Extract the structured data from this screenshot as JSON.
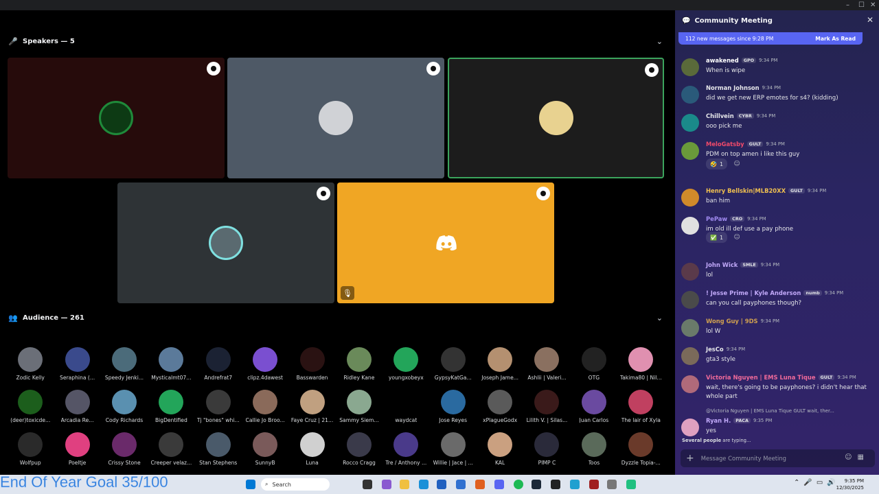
{
  "window": {
    "minimize": "–",
    "maximize": "☐",
    "close": "✕"
  },
  "speakers": {
    "title": "Speakers — 5",
    "icon": "microphone-icon",
    "chevron": "⌄"
  },
  "audience": {
    "title": "Audience — 261",
    "icon": "people-icon",
    "chevron": "⌄",
    "members": [
      "Zodic Kelly",
      "Seraphina (...",
      "Speedy Jenki...",
      "Mysticalmt07...",
      "Andrefrat7",
      "clipz.4dawest",
      "Basswarden",
      "Ridley Kane",
      "youngxobeyx",
      "GypsyKatGa...",
      "Joseph Jame...",
      "Ashlii | Valeri...",
      "OTG",
      "Takima80 | Nil...",
      "(deer)toxicde...",
      "Arcadia Re...",
      "Cody Richards",
      "BigDentified",
      "Tj \"bones\" whi...",
      "Callie Jo Broo...",
      "Faye Cruz | 21...",
      "Sammy Siem...",
      "waydcat",
      "Jose Reyes",
      "xPlagueGodx",
      "Lilith V. | Silas...",
      "Juan Carlos",
      "The lair of Xyla",
      "Wolfpup",
      "Poeltje",
      "Crissy Stone",
      "Creeper velaz...",
      "Stan Stephens",
      "SunnyB",
      "Luna",
      "Rocco Cragg",
      "Tre / Anthony ...",
      "Willie | Jace | ...",
      "KAL",
      "PIMP C",
      "Toos",
      "Dyzzle Topia-..."
    ],
    "member_colors": [
      "#6b6f78",
      "#3a4a8c",
      "#4b6b7a",
      "#5b7a9a",
      "#1b2233",
      "#7a4fd0",
      "#2a1212",
      "#6a8a5a",
      "#23a55a",
      "#333",
      "#b49070",
      "#8a7060",
      "#222",
      "#e090b0",
      "#1c5e1c",
      "#556",
      "#5a90b0",
      "#23a55a",
      "#3a3a3a",
      "#8a6a5a",
      "#c0a080",
      "#8aa890",
      "#000",
      "#2a6aa0",
      "#5a5a5a",
      "#3a1a1a",
      "#6a4aa0",
      "#c04060",
      "#2a2a2a",
      "#e04080",
      "#6a2a6a",
      "#3a3a3a",
      "#4a5a6a",
      "#7a5a5a",
      "#d0d0d0",
      "#3a3a4a",
      "#4a3a8a",
      "#6a6a6a",
      "#caa080",
      "#2a2a3a",
      "#5a6a5a",
      "#6a3a2a"
    ]
  },
  "chat": {
    "title": "Community Meeting",
    "close": "✕",
    "new_messages": "112 new messages since 9:28 PM",
    "mark_read": "Mark As Read",
    "messages": [
      {
        "user": "awakened",
        "tag": "GPO",
        "time": "9:34 PM",
        "text": "When is wipe",
        "color": "#ffffff",
        "avatar": "#5a6a3a"
      },
      {
        "user": "Norman Johnson",
        "tag": "",
        "time": "9:34 PM",
        "text": "did we get new ERP emotes for s4? (kidding)",
        "color": "#e6e7ea",
        "avatar": "#2a5a7a"
      },
      {
        "user": "Chillvein",
        "tag": "CYBR",
        "time": "9:34 PM",
        "text": "ooo pick me",
        "color": "#e6e7ea",
        "avatar": "#1a8a8a"
      },
      {
        "user": "MeloGatsby",
        "tag": "GULT",
        "time": "9:34 PM",
        "text": "PDM on top amen i like this guy",
        "color": "#f04a6a",
        "avatar": "#6a9a3a"
      },
      {
        "user": "Henry Bellskin|MLB20XX",
        "tag": "GULT",
        "time": "9:34 PM",
        "text": "ban him",
        "color": "#f0c050",
        "avatar": "#d08a2a"
      },
      {
        "user": "PePaw",
        "tag": "CRO",
        "time": "9:34 PM",
        "text": "im old ill def use a pay phone",
        "color": "#a08af0",
        "avatar": "#e0e0e0"
      },
      {
        "user": "John Wick",
        "tag": "SMLE",
        "time": "9:34 PM",
        "text": "lol",
        "color": "#c0a8f8",
        "avatar": "#5a3a4a"
      },
      {
        "user": "! Jesse Prime | Kyle Anderson",
        "tag": "numb",
        "time": "9:34 PM",
        "text": "can you call payphones though?",
        "color": "#c0a8f8",
        "avatar": "#4a4a4a"
      },
      {
        "user": "Wong Guy | 9DS",
        "tag": "",
        "time": "9:34 PM",
        "text": "lol W",
        "color": "#d0a050",
        "avatar": "#6a7a6a"
      },
      {
        "user": "JesCo",
        "tag": "",
        "time": "9:34 PM",
        "text": "gta3 style",
        "color": "#e6e7ea",
        "avatar": "#7a6a5a"
      },
      {
        "user": "Victoria Nguyen | EMS Luna Tique",
        "tag": "GULT",
        "time": "9:34 PM",
        "text": "wait, there's going to be payphones? i didn't hear that whole part",
        "color": "#f06a9a",
        "avatar": "#b06a7a"
      },
      {
        "user": "Ryan H.",
        "tag": "PACA",
        "time": "9:35 PM",
        "text": "yes",
        "color": "#c0a8f8",
        "avatar": "#e0a0c0"
      }
    ],
    "reply_preview": "@Victoria Nguyen | EMS Luna Tique  GULT  wait, ther...",
    "reactions": [
      {
        "emoji": "🤣",
        "count": "1"
      },
      {
        "emoji": "✅",
        "count": "1"
      }
    ],
    "typing_bold": "Several people",
    "typing_rest": " are typing...",
    "composer_placeholder": "Message Community Meeting"
  },
  "overlay": {
    "goal": "End Of Year Goal 35/100"
  },
  "taskbar": {
    "search": "Search",
    "time": "9:35 PM",
    "date": "12/30/2025"
  },
  "colors": {
    "tile1": "#260b0b",
    "tile2": "#4e5966",
    "tile3": "#1c1c1c",
    "tile4": "#2e3336",
    "tile5": "#f0a624",
    "active_border": "#3ba55d",
    "accent": "#5865f2"
  }
}
